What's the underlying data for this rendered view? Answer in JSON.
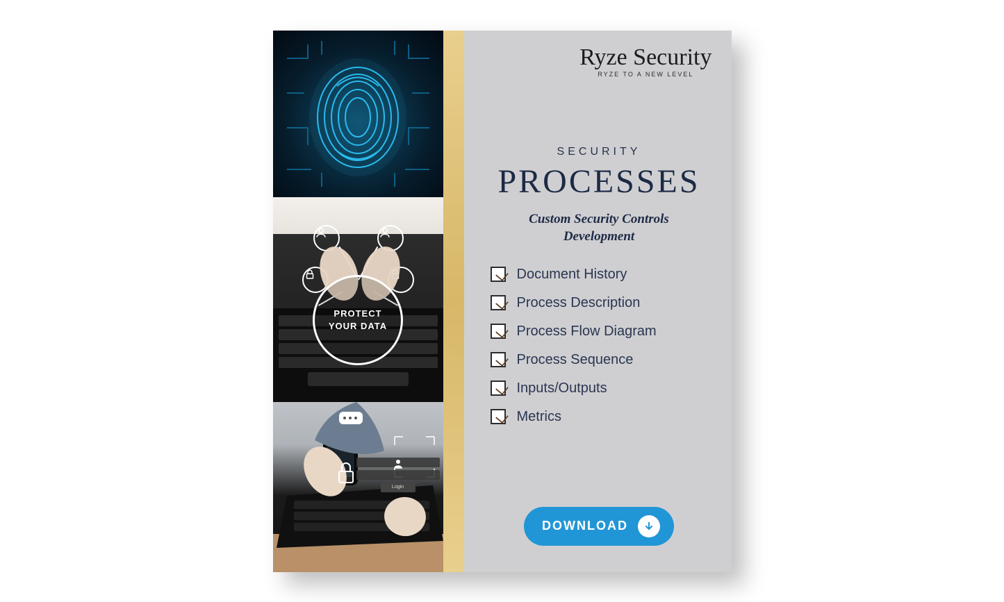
{
  "brand": {
    "name": "Ryze Security",
    "tagline": "RYZE TO A NEW LEVEL"
  },
  "kicker": "SECURITY",
  "title": "PROCESSES",
  "subtitle_line1": "Custom Security Controls",
  "subtitle_line2": "Development",
  "protect_line1": "PROTECT",
  "protect_line2": "YOUR DATA",
  "checklist": [
    "Document History",
    "Process Description",
    "Process Flow Diagram",
    "Process Sequence",
    "Inputs/Outputs",
    "Metrics"
  ],
  "download_label": "DOWNLOAD",
  "login_label": "Login"
}
